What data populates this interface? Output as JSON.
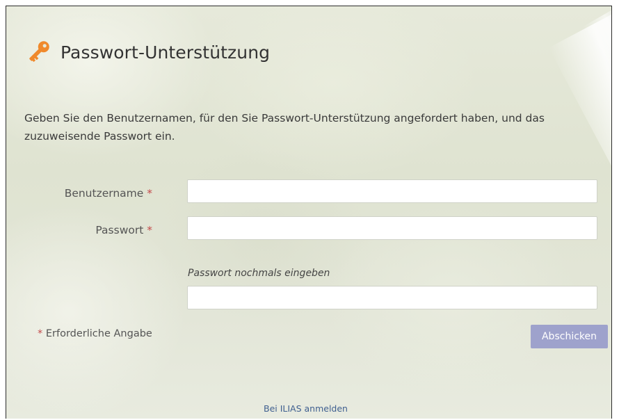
{
  "header": {
    "icon": "key-icon",
    "title": "Passwort-Unterstützung"
  },
  "intro": {
    "text": "Geben Sie den Benutzernamen, für den Sie Passwort-Unterstützung angefordert haben, und das zuzuweisende Passwort ein."
  },
  "form": {
    "username": {
      "label": "Benutzername",
      "required_marker": "*",
      "value": ""
    },
    "password": {
      "label": "Passwort",
      "required_marker": "*",
      "value": ""
    },
    "password_repeat": {
      "label": "Passwort nochmals eingeben",
      "value": ""
    },
    "required_note": {
      "marker": "*",
      "text": "Erforderliche Angabe"
    },
    "submit_label": "Abschicken"
  },
  "footer": {
    "login_link": "Bei ILIAS anmelden"
  },
  "colors": {
    "accent_key": "#f0892b",
    "required": "#c44a4a",
    "submit_bg": "#9ea2cc",
    "link": "#3f5f8f"
  }
}
